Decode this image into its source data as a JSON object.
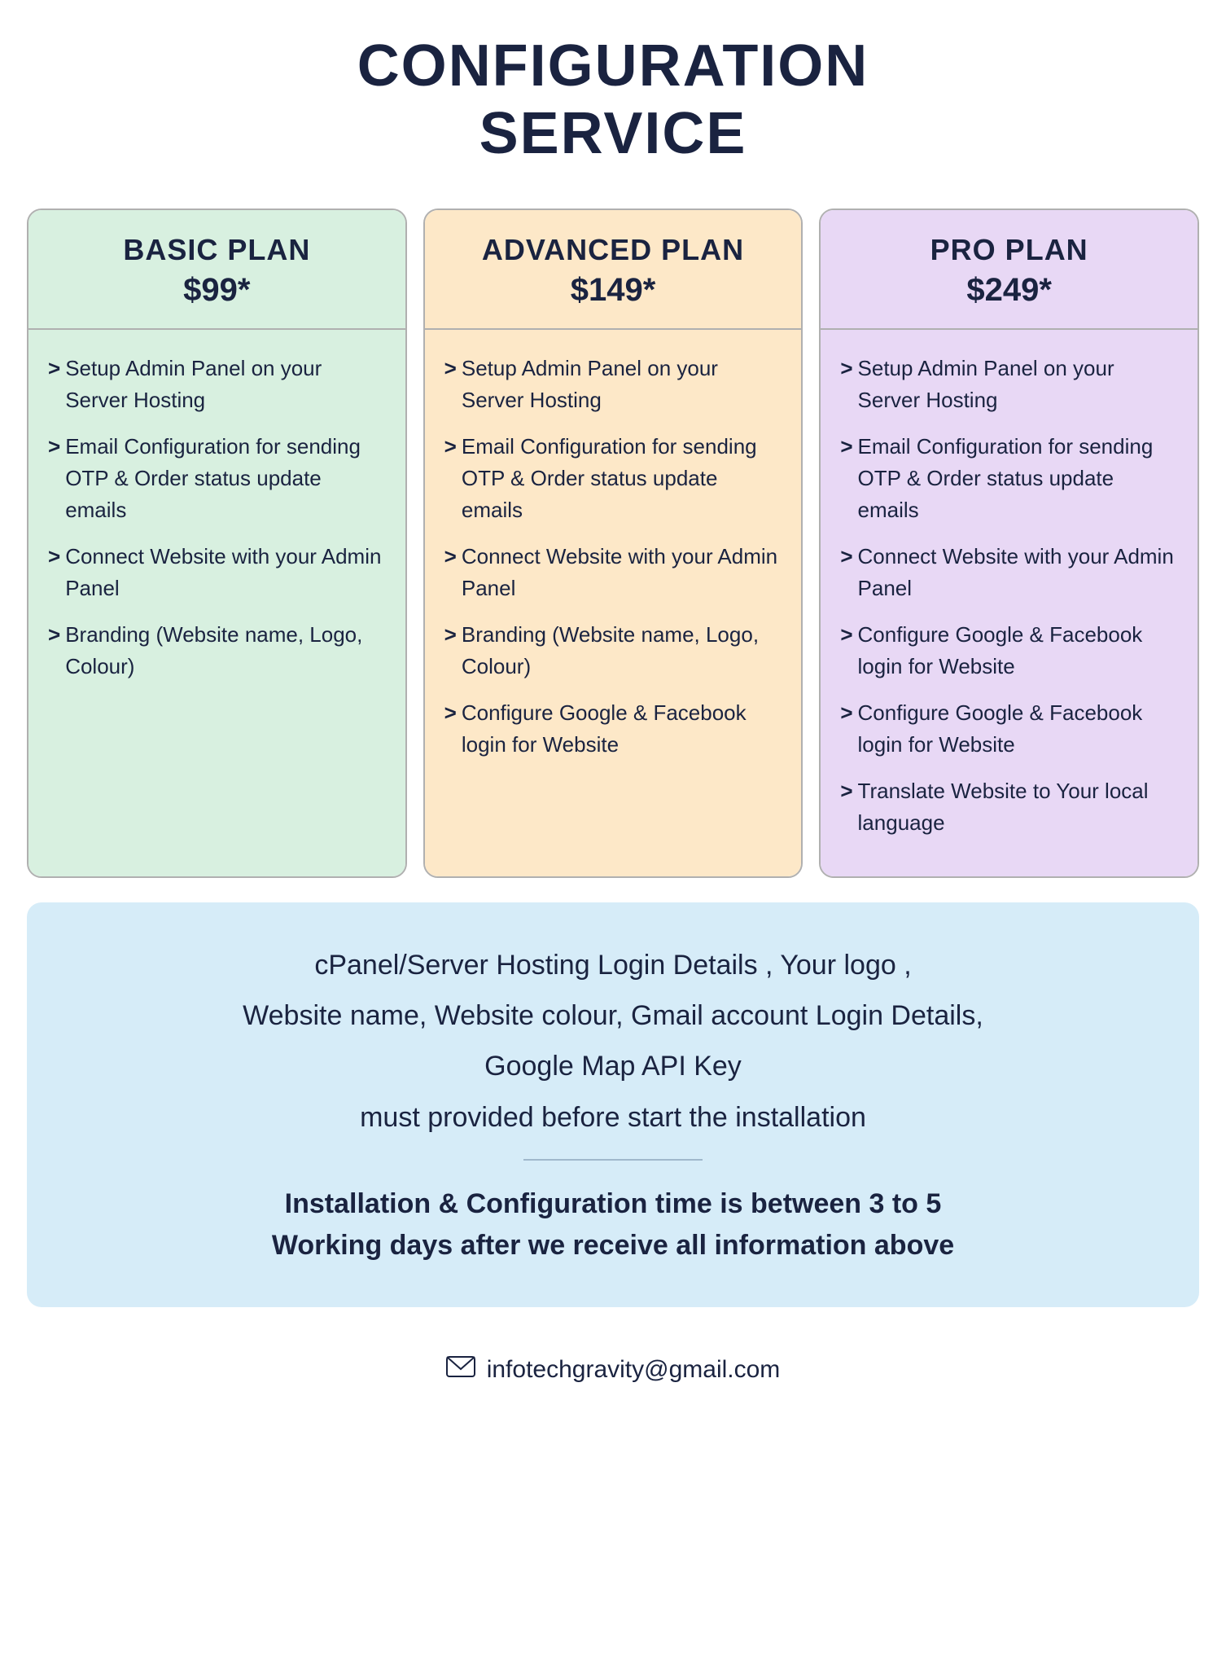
{
  "page": {
    "title_line1": "CONFIGURATION",
    "title_line2": "SERVICE"
  },
  "plans": [
    {
      "id": "basic",
      "name": "BASIC PLAN",
      "price": "$99*",
      "features": [
        "Setup Admin Panel on your Server Hosting",
        "Email Configuration for sending OTP & Order status update emails",
        "Connect Website with your Admin Panel",
        "Branding (Website name, Logo, Colour)"
      ]
    },
    {
      "id": "advanced",
      "name": "ADVANCED PLAN",
      "price": "$149*",
      "features": [
        "Setup Admin Panel on your Server Hosting",
        "Email Configuration for sending OTP & Order status update emails",
        "Connect Website with your Admin Panel",
        "Branding (Website name, Logo, Colour)",
        "Configure Google & Facebook login for Website"
      ]
    },
    {
      "id": "pro",
      "name": "PRO PLAN",
      "price": "$249*",
      "features": [
        "Setup Admin Panel on your Server Hosting",
        "Email Configuration for sending OTP & Order status update emails",
        "Connect Website with your Admin Panel",
        "Configure Google & Facebook login for Website",
        "Configure Google & Facebook login for Website",
        "Translate Website to Your local language"
      ]
    }
  ],
  "info": {
    "text1": "cPanel/Server Hosting Login Details , Your logo ,",
    "text2": "Website name, Website colour, Gmail account Login Details,",
    "text3": "Google Map API Key",
    "text4": "must provided before start the installation",
    "bold1": "Installation & Configuration time is between 3 to 5",
    "bold2": "Working days after we receive all information above"
  },
  "footer": {
    "email": "infotechgravity@gmail.com"
  }
}
